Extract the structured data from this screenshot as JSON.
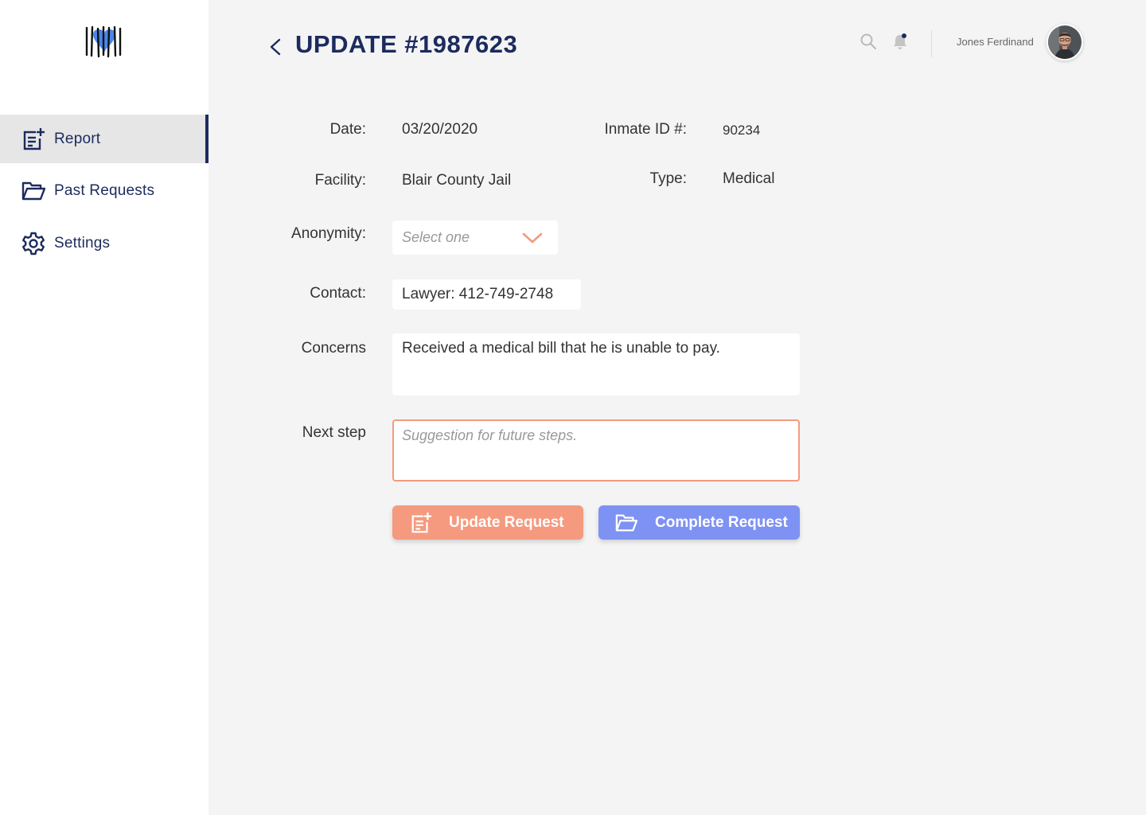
{
  "sidebar": {
    "items": [
      {
        "label": "Report",
        "icon": "report-add-icon",
        "active": true
      },
      {
        "label": "Past Requests",
        "icon": "folder-open-icon",
        "active": false
      },
      {
        "label": "Settings",
        "icon": "gear-icon",
        "active": false
      }
    ]
  },
  "header": {
    "title": "UPDATE #1987623",
    "user_name": "Jones Ferdinand"
  },
  "form": {
    "date": {
      "label": "Date:",
      "value": "03/20/2020"
    },
    "inmate_id": {
      "label": "Inmate ID #:",
      "value": "90234"
    },
    "facility": {
      "label": "Facility:",
      "value": "Blair County Jail"
    },
    "type": {
      "label": "Type:",
      "value": "Medical"
    },
    "anonymity": {
      "label": "Anonymity:",
      "placeholder": "Select one"
    },
    "contact": {
      "label": "Contact:",
      "value": "Lawyer: 412-749-2748"
    },
    "concerns": {
      "label": "Concerns",
      "value": "Received a medical bill that he is unable to pay."
    },
    "next_step": {
      "label": "Next step",
      "placeholder": "Suggestion for future steps."
    }
  },
  "actions": {
    "update_label": "Update Request",
    "complete_label": "Complete Request"
  },
  "colors": {
    "navy": "#1c2b5e",
    "accent_orange": "#f59a7e",
    "accent_blue": "#7d92f3",
    "logo_heart": "#4a86e8"
  }
}
